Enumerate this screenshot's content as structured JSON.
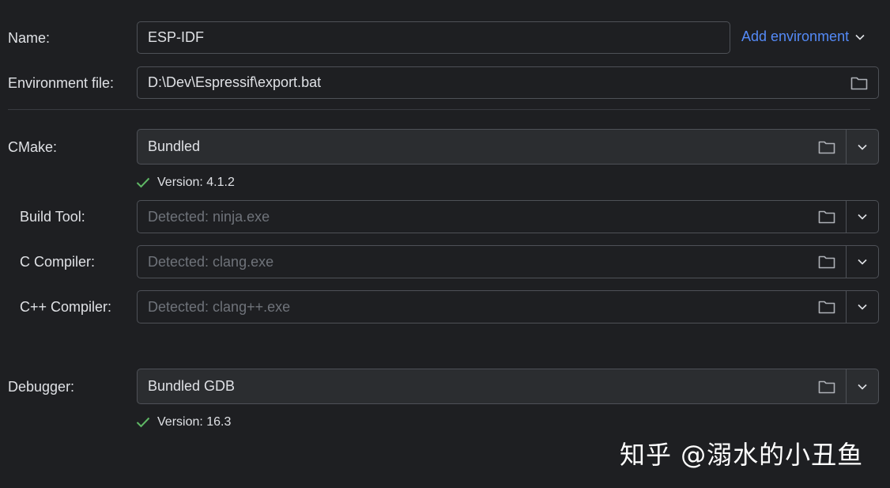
{
  "name": {
    "label": "Name:",
    "value": "ESP-IDF"
  },
  "add_environment": {
    "label": "Add environment",
    "icon": "chevron-down-icon"
  },
  "environment_file": {
    "label": "Environment file:",
    "value": "D:\\Dev\\Espressif\\export.bat",
    "icon": "folder-icon"
  },
  "cmake": {
    "label": "CMake:",
    "value": "Bundled",
    "version": "Version: 4.1.2"
  },
  "build_tool": {
    "label": "Build Tool:",
    "placeholder": "Detected: ninja.exe"
  },
  "c_compiler": {
    "label": "C Compiler:",
    "placeholder": "Detected: clang.exe"
  },
  "cpp_compiler": {
    "label": "C++ Compiler:",
    "placeholder": "Detected: clang++.exe"
  },
  "debugger": {
    "label": "Debugger:",
    "value": "Bundled GDB",
    "version": "Version: 16.3"
  },
  "watermark": {
    "text": "知乎 @溺水的小丑鱼"
  },
  "colors": {
    "background": "#1e1f22",
    "field_border": "#4e5157",
    "link": "#548af7",
    "success_check": "#5fb865",
    "placeholder": "#6f737a"
  }
}
